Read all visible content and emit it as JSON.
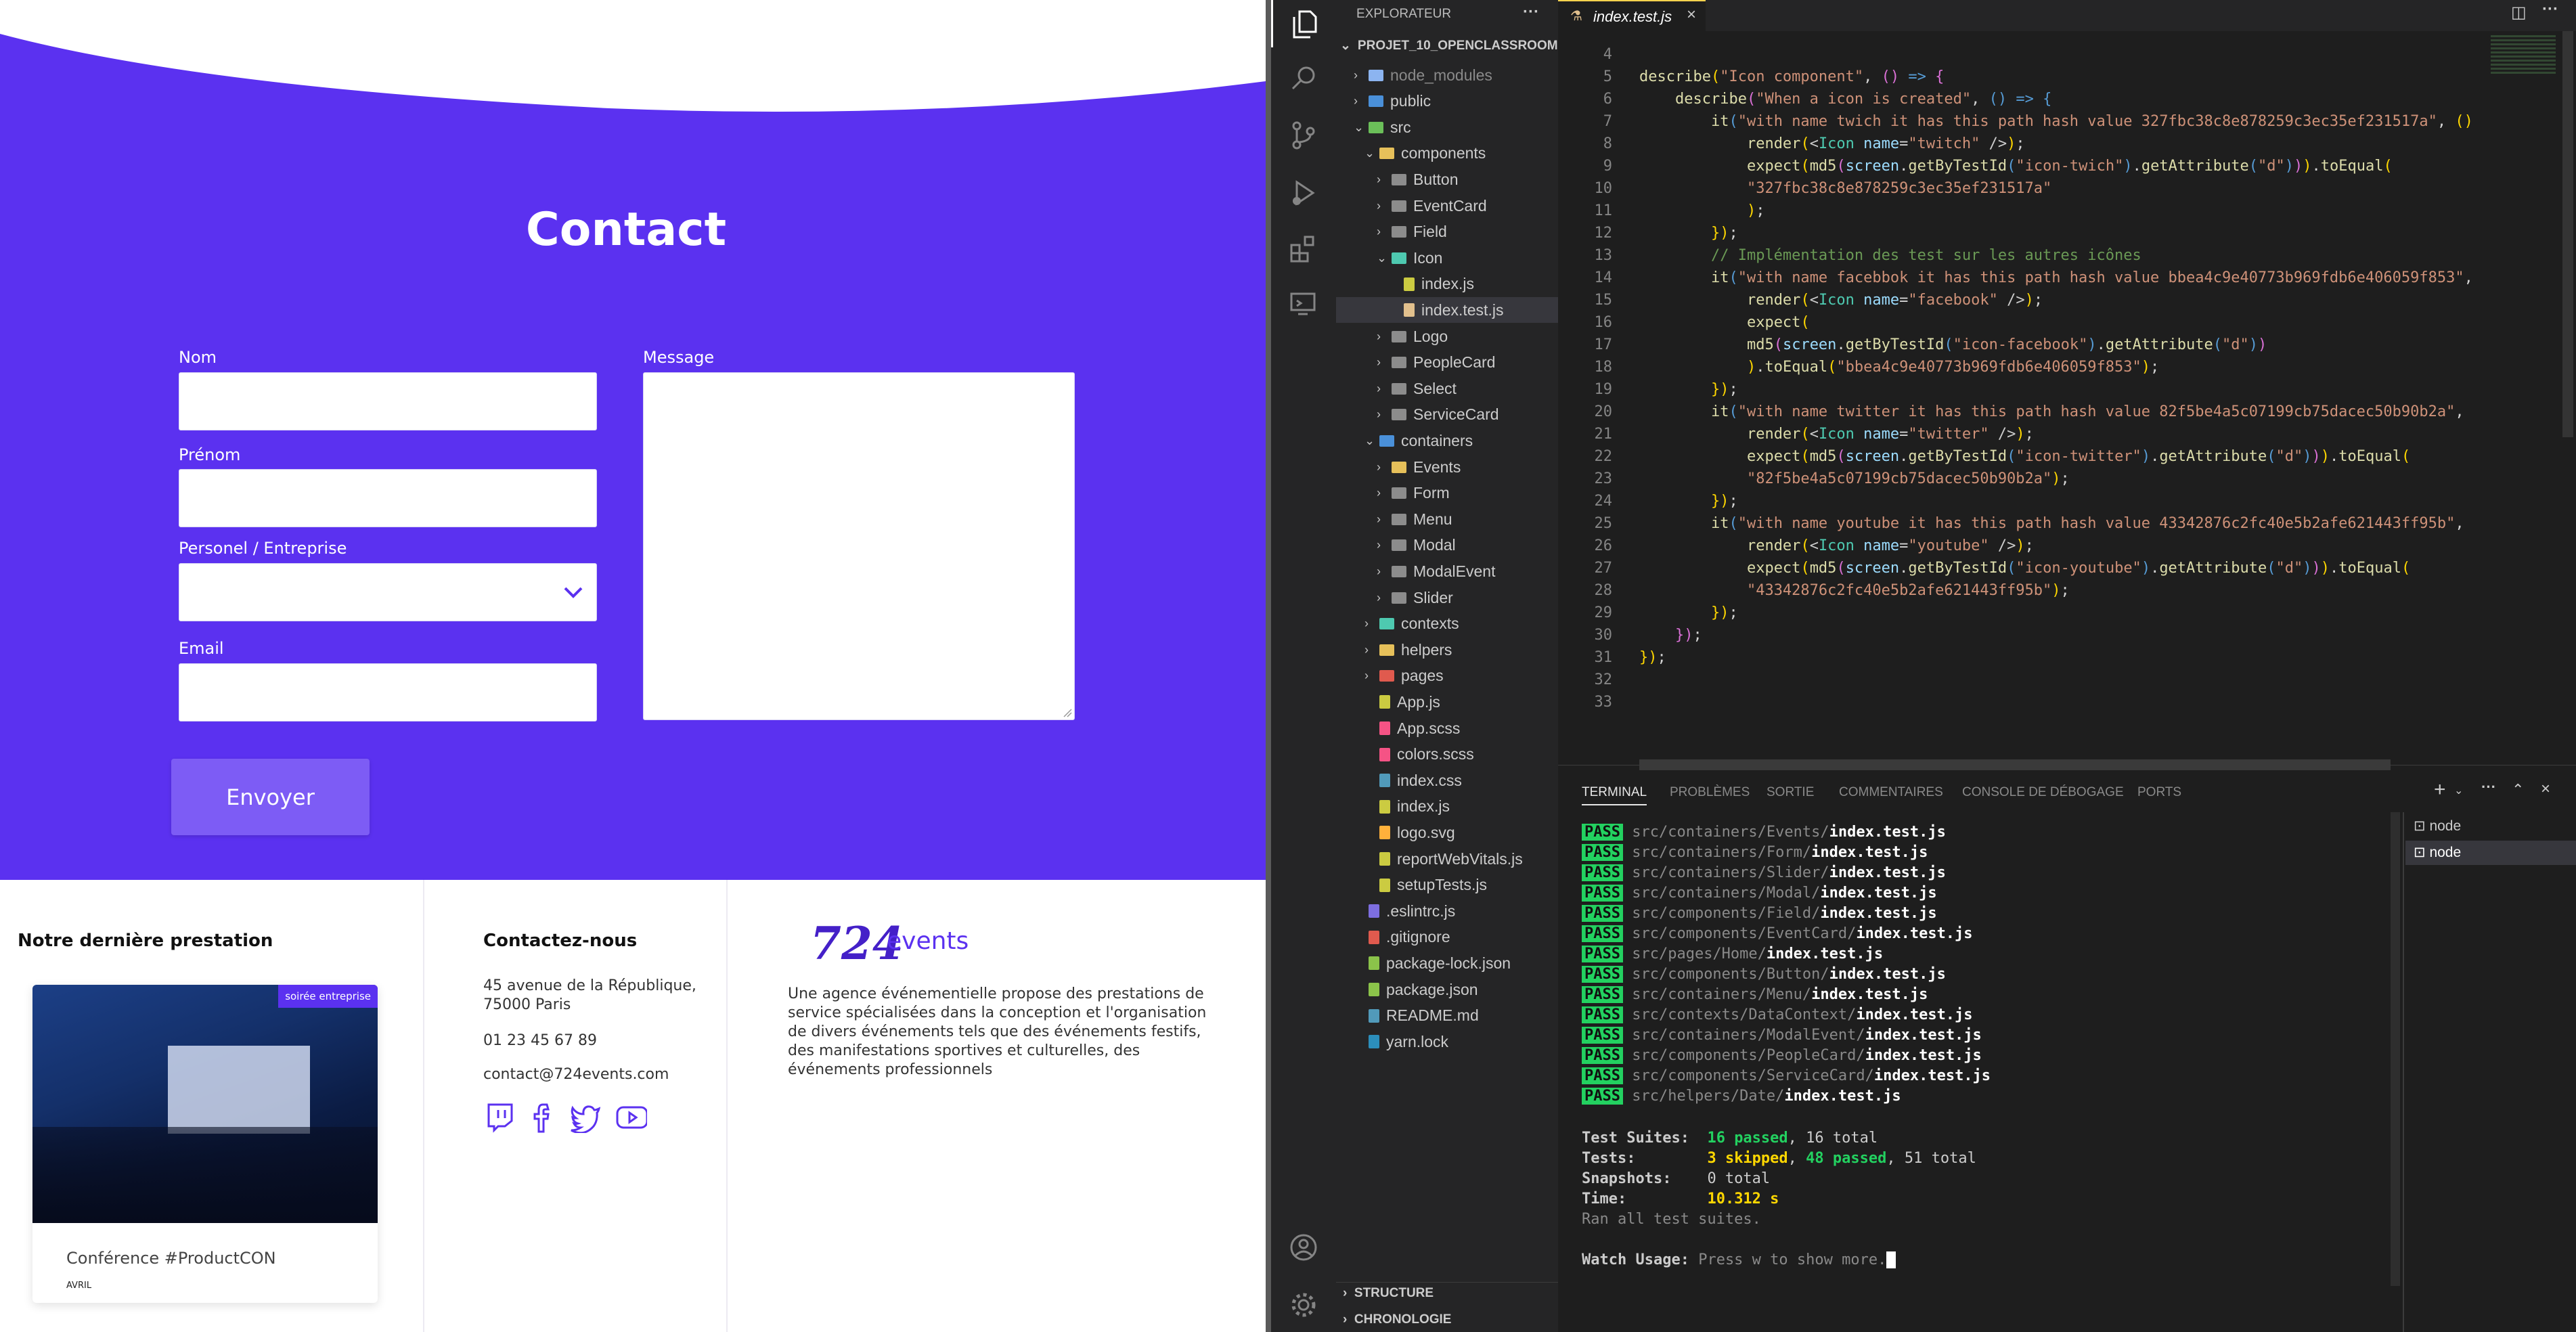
{
  "site": {
    "contact_title": "Contact",
    "form": {
      "nom_label": "Nom",
      "prenom_label": "Prénom",
      "type_label": "Personel / Entreprise",
      "email_label": "Email",
      "message_label": "Message",
      "submit_label": "Envoyer"
    },
    "footer": {
      "last_title": "Notre dernière prestation",
      "card_badge": "soirée entreprise",
      "card_title": "Conférence #ProductCON",
      "card_month": "AVRIL",
      "contact_title": "Contactez-nous",
      "address_line1": "45 avenue de la République,",
      "address_line2": "75000 Paris",
      "phone": "01 23 45 67 89",
      "email": "contact@724events.com",
      "logo_number": "724",
      "logo_word": "events",
      "desc_lines": [
        "Une agence événementielle propose des prestations de",
        "service spécialisées dans la conception et l'organisation",
        "de divers événements tels que des événements festifs,",
        "des manifestations sportives et culturelles, des",
        "événements professionnels"
      ]
    }
  },
  "vscode": {
    "explorer_title": "EXPLORATEUR",
    "project_name": "PROJET_10_OPENCLASSROOM...",
    "tab_label": "index.test.js",
    "tree": [
      {
        "label": "node_modules",
        "kind": "folder",
        "depth": 1,
        "color": "#8cb4f0"
      },
      {
        "label": "public",
        "kind": "folder",
        "depth": 1,
        "color": "#4a90d9"
      },
      {
        "label": "src",
        "kind": "folder-open",
        "depth": 1,
        "color": "#6bbf59"
      },
      {
        "label": "components",
        "kind": "folder-open",
        "depth": 2,
        "color": "#e6c05a"
      },
      {
        "label": "Button",
        "kind": "folder",
        "depth": 3,
        "color": "#8c8c8c"
      },
      {
        "label": "EventCard",
        "kind": "folder",
        "depth": 3,
        "color": "#8c8c8c"
      },
      {
        "label": "Field",
        "kind": "folder",
        "depth": 3,
        "color": "#8c8c8c"
      },
      {
        "label": "Icon",
        "kind": "folder-open",
        "depth": 3,
        "color": "#4ec9b0"
      },
      {
        "label": "index.js",
        "kind": "file",
        "depth": 4,
        "color": "#cbcb41"
      },
      {
        "label": "index.test.js",
        "kind": "file",
        "depth": 4,
        "color": "#e2c08d"
      },
      {
        "label": "Logo",
        "kind": "folder",
        "depth": 3,
        "color": "#8c8c8c"
      },
      {
        "label": "PeopleCard",
        "kind": "folder",
        "depth": 3,
        "color": "#8c8c8c"
      },
      {
        "label": "Select",
        "kind": "folder",
        "depth": 3,
        "color": "#8c8c8c"
      },
      {
        "label": "ServiceCard",
        "kind": "folder",
        "depth": 3,
        "color": "#8c8c8c"
      },
      {
        "label": "containers",
        "kind": "folder-open",
        "depth": 2,
        "color": "#4a90d9"
      },
      {
        "label": "Events",
        "kind": "folder",
        "depth": 3,
        "color": "#e6c05a"
      },
      {
        "label": "Form",
        "kind": "folder",
        "depth": 3,
        "color": "#8c8c8c"
      },
      {
        "label": "Menu",
        "kind": "folder",
        "depth": 3,
        "color": "#8c8c8c"
      },
      {
        "label": "Modal",
        "kind": "folder",
        "depth": 3,
        "color": "#8c8c8c"
      },
      {
        "label": "ModalEvent",
        "kind": "folder",
        "depth": 3,
        "color": "#8c8c8c"
      },
      {
        "label": "Slider",
        "kind": "folder",
        "depth": 3,
        "color": "#8c8c8c"
      },
      {
        "label": "contexts",
        "kind": "folder",
        "depth": 2,
        "color": "#4ec9b0"
      },
      {
        "label": "helpers",
        "kind": "folder",
        "depth": 2,
        "color": "#e6c05a"
      },
      {
        "label": "pages",
        "kind": "folder",
        "depth": 2,
        "color": "#e05a4e"
      },
      {
        "label": "App.js",
        "kind": "file",
        "depth": 2,
        "color": "#cbcb41"
      },
      {
        "label": "App.scss",
        "kind": "file",
        "depth": 2,
        "color": "#f55385"
      },
      {
        "label": "colors.scss",
        "kind": "file",
        "depth": 2,
        "color": "#f55385"
      },
      {
        "label": "index.css",
        "kind": "file",
        "depth": 2,
        "color": "#519aba"
      },
      {
        "label": "index.js",
        "kind": "file",
        "depth": 2,
        "color": "#cbcb41"
      },
      {
        "label": "logo.svg",
        "kind": "file",
        "depth": 2,
        "color": "#ffb13b"
      },
      {
        "label": "reportWebVitals.js",
        "kind": "file",
        "depth": 2,
        "color": "#cbcb41"
      },
      {
        "label": "setupTests.js",
        "kind": "file",
        "depth": 2,
        "color": "#cbcb41"
      },
      {
        "label": ".eslintrc.js",
        "kind": "file",
        "depth": 1,
        "color": "#7d6ee0"
      },
      {
        "label": ".gitignore",
        "kind": "file",
        "depth": 1,
        "color": "#e05a4e"
      },
      {
        "label": "package-lock.json",
        "kind": "file",
        "depth": 1,
        "color": "#8bc34a"
      },
      {
        "label": "package.json",
        "kind": "file",
        "depth": 1,
        "color": "#8bc34a"
      },
      {
        "label": "README.md",
        "kind": "file",
        "depth": 1,
        "color": "#519aba"
      },
      {
        "label": "yarn.lock",
        "kind": "file",
        "depth": 1,
        "color": "#2c8ebb"
      }
    ],
    "structure_label": "STRUCTURE",
    "timeline_label": "CHRONOLOGIE",
    "panel_tabs": [
      "TERMINAL",
      "PROBLÈMES",
      "SORTIE",
      "COMMENTAIRES",
      "CONSOLE DE DÉBOGAGE",
      "PORTS"
    ],
    "terminal_instances": [
      "node",
      "node"
    ],
    "test_paths": [
      "src/containers/Events/",
      "src/containers/Form/",
      "src/containers/Slider/",
      "src/containers/Modal/",
      "src/components/Field/",
      "src/components/EventCard/",
      "src/pages/Home/",
      "src/components/Button/",
      "src/containers/Menu/",
      "src/contexts/DataContext/",
      "src/containers/ModalEvent/",
      "src/components/PeopleCard/",
      "src/components/ServiceCard/",
      "src/helpers/Date/"
    ],
    "test_file": "index.test.js",
    "pass_label": "PASS",
    "summary": {
      "suites_label": "Test Suites:",
      "suites_passed": "16 passed",
      "suites_total": ", 16 total",
      "tests_label": "Tests:",
      "tests_skipped": "3 skipped",
      "tests_passed": "48 passed",
      "tests_total": ", 51 total",
      "snap_label": "Snapshots:",
      "snap_value": "0 total",
      "time_label": "Time:",
      "time_value": "10.312 s",
      "ran_all": "Ran all test suites.",
      "watch_label": "Watch Usage:",
      "watch_value": "Press w to show more."
    }
  }
}
